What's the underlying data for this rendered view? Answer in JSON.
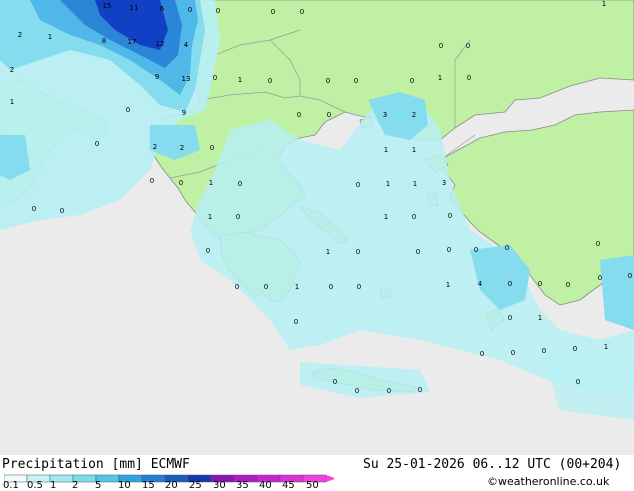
{
  "map": {
    "colors": {
      "sea": "#ebebeb",
      "land": "#bff0a3",
      "precip_light": "#b6f0f4",
      "precip_mid": "#86dcef",
      "precip_heavy": "#4fb8e8",
      "precip_strong": "#2c86d8",
      "precip_extreme": "#1240c4",
      "coastline": "#7a7a7a",
      "border": "#999999"
    },
    "value_labels": [
      {
        "v": "2"
      },
      {
        "v": "1"
      },
      {
        "v": "15"
      },
      {
        "v": "11"
      },
      {
        "v": "6"
      },
      {
        "v": "0"
      },
      {
        "v": "0"
      },
      {
        "v": "0"
      },
      {
        "v": "0"
      },
      {
        "v": "1"
      },
      {
        "v": "2"
      },
      {
        "v": "1"
      },
      {
        "v": "8"
      },
      {
        "v": "17"
      },
      {
        "v": "12"
      },
      {
        "v": "4"
      },
      {
        "v": "0"
      },
      {
        "v": "1"
      },
      {
        "v": "9"
      },
      {
        "v": "13"
      },
      {
        "v": "0"
      },
      {
        "v": "0"
      },
      {
        "v": "0"
      },
      {
        "v": "0"
      },
      {
        "v": "0"
      },
      {
        "v": "1"
      },
      {
        "v": "0"
      },
      {
        "v": "0"
      },
      {
        "v": "0"
      },
      {
        "v": "9"
      },
      {
        "v": "0"
      },
      {
        "v": "0"
      },
      {
        "v": "3"
      },
      {
        "v": "2"
      },
      {
        "v": "0"
      },
      {
        "v": "2"
      },
      {
        "v": "2"
      },
      {
        "v": "0"
      },
      {
        "v": "1"
      },
      {
        "v": "1"
      },
      {
        "v": "0"
      },
      {
        "v": "0"
      },
      {
        "v": "1"
      },
      {
        "v": "0"
      },
      {
        "v": "1"
      },
      {
        "v": "1"
      },
      {
        "v": "3"
      },
      {
        "v": "0"
      },
      {
        "v": "0"
      },
      {
        "v": "0"
      },
      {
        "v": "1"
      },
      {
        "v": "0"
      },
      {
        "v": "1"
      },
      {
        "v": "0"
      },
      {
        "v": "0"
      },
      {
        "v": "0"
      },
      {
        "v": "0"
      },
      {
        "v": "0"
      },
      {
        "v": "0"
      },
      {
        "v": "1"
      },
      {
        "v": "0"
      },
      {
        "v": "0"
      },
      {
        "v": "0"
      },
      {
        "v": "0"
      },
      {
        "v": "0"
      },
      {
        "v": "1"
      },
      {
        "v": "0"
      },
      {
        "v": "0"
      },
      {
        "v": "1"
      },
      {
        "v": "4"
      },
      {
        "v": "0"
      },
      {
        "v": "0"
      },
      {
        "v": "0"
      },
      {
        "v": "0"
      },
      {
        "v": "0"
      },
      {
        "v": "0"
      },
      {
        "v": "0"
      },
      {
        "v": "1"
      },
      {
        "v": "0"
      },
      {
        "v": "0"
      },
      {
        "v": "0"
      },
      {
        "v": "0"
      },
      {
        "v": "1"
      },
      {
        "v": "0"
      },
      {
        "v": "0"
      },
      {
        "v": "0"
      },
      {
        "v": "0"
      },
      {
        "v": "0"
      }
    ]
  },
  "footer": {
    "title": "Precipitation [mm]  ECMWF",
    "datetime": "Su 25-01-2026 06..12 UTC (00+204)",
    "credit": "©weatheronline.co.uk",
    "legend_ticks": [
      "0.1",
      "0.5",
      "1",
      "2",
      "5",
      "10",
      "15",
      "20",
      "25",
      "30",
      "35",
      "40",
      "45",
      "50"
    ],
    "legend_colors": [
      "#f0fcfc",
      "#c8f4f8",
      "#a0eaf2",
      "#78dcee",
      "#50c6ea",
      "#2ca6e2",
      "#2080d4",
      "#1a5cc4",
      "#1438b0",
      "#8a14b8",
      "#ae1cc8",
      "#c824d4",
      "#e030dc",
      "#f040e0"
    ]
  }
}
